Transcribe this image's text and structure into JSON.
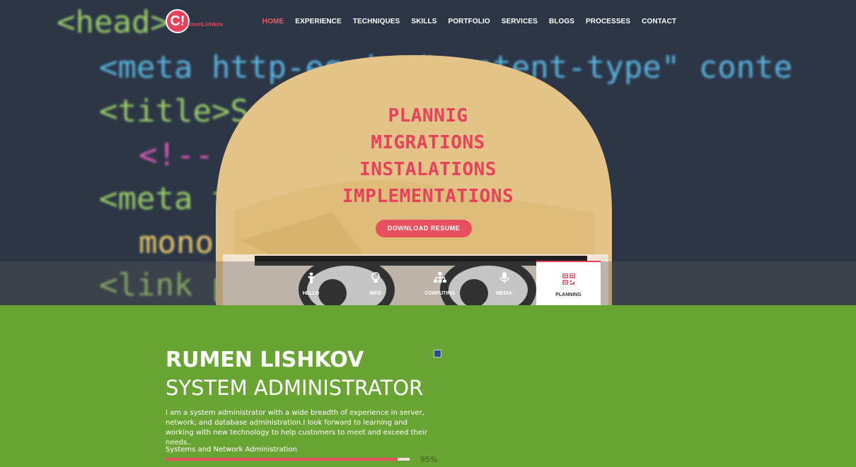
{
  "brand": {
    "logo_letter": "C!",
    "logo_text": "RumenLishkov"
  },
  "nav": {
    "items": [
      {
        "label": "HOME",
        "active": true
      },
      {
        "label": "EXPERIENCE",
        "active": false
      },
      {
        "label": "TECHNIQUES",
        "active": false
      },
      {
        "label": "SKILLS",
        "active": false
      },
      {
        "label": "PORTFOLIO",
        "active": false
      },
      {
        "label": "SERVICES",
        "active": false
      },
      {
        "label": "BLOGS",
        "active": false
      },
      {
        "label": "PROCESSES",
        "active": false
      },
      {
        "label": "CONTACT",
        "active": false
      }
    ]
  },
  "hero": {
    "lines": [
      "PLANNIG",
      "MIGRATIONS",
      "INSTALATIONS",
      "IMPLEMENTATIONS"
    ],
    "button_label": "DOWNLOAD RESUME",
    "bg_code": [
      "<head>",
      "<meta http-equiv=\"content-type\" conte",
      "<title>S              </title>",
      "<!--                 AFDKO -->",
      "<meta                tent=\"sans,",
      "mono                 coding, for",
      "<link                pe=\"text/css"
    ]
  },
  "tabs": [
    {
      "label": "HELLO",
      "icon": "person-icon",
      "active": false
    },
    {
      "label": "INFO",
      "icon": "lightbulb-icon",
      "active": false
    },
    {
      "label": "COMPUTING",
      "icon": "sitemap-icon",
      "active": false
    },
    {
      "label": "MEDIA",
      "icon": "microphone-icon",
      "active": false
    },
    {
      "label": "PLANNING",
      "icon": "qrcode-icon",
      "active": true
    }
  ],
  "about": {
    "name": "RUMEN LISHKOV",
    "role": "SYSTEM ADMINISTRATOR",
    "bio": "I am a system administrator with a wide breadth of experience in server, network, and database administration.I look forward to learning and working with new technology to help customers to meet and exceed their needs..",
    "skill": {
      "label": "Systems and Network Administration",
      "percent_text": "95%",
      "percent": 95
    }
  },
  "colors": {
    "accent": "#e8415c",
    "green": "#6aa434",
    "hero_bg": "#2c3646"
  }
}
